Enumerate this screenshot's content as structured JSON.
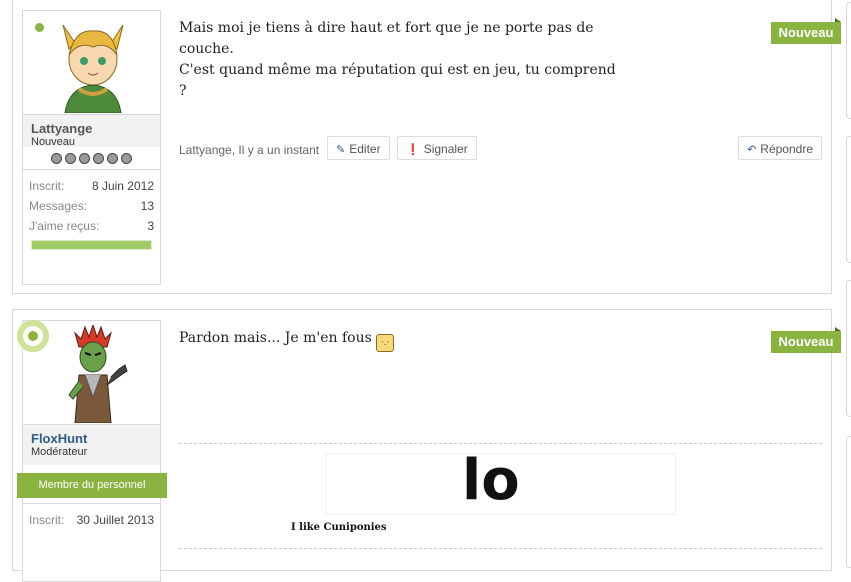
{
  "posts": [
    {
      "author": "Lattyange",
      "user_title": "Nouveau",
      "online": true,
      "rating_balls": [
        "grey",
        "grey",
        "grey",
        "grey",
        "grey",
        "grey"
      ],
      "stats": [
        {
          "label": "Inscrit:",
          "value": "8 Juin 2012"
        },
        {
          "label": "Messages:",
          "value": "13"
        },
        {
          "label": "J'aime reçus:",
          "value": "3"
        }
      ],
      "like_progress": 1.0,
      "message_lines": [
        "Mais moi je tiens à dire haut et fort que je ne porte pas de couche.",
        "C'est quand même ma réputation qui est en jeu, tu comprend ?"
      ],
      "badge": "Nouveau",
      "date_text": "Lattyange, Il y a un instant",
      "edit_label": "Editer",
      "report_label": "Signaler",
      "reply_label": "Répondre"
    },
    {
      "author": "FloxHunt",
      "user_title": "Modérateur",
      "staff_banner": "Membre du personnel",
      "online": true,
      "rating_balls": [
        "yellow",
        "yellow",
        "red",
        "red",
        "red",
        "red"
      ],
      "stats": [
        {
          "label": "Inscrit:",
          "value": "30 Juillet 2013"
        }
      ],
      "message_text": "Pardon mais... Je m'en fous",
      "badge": "Nouveau",
      "signature_text": "lo",
      "signature_caption": "I like Cuniponies"
    }
  ],
  "colors": {
    "accent": "#8ab33f",
    "username_link": "#2f5c8c",
    "border": "#d9d9d9"
  },
  "icons": {
    "edit": "pencil-icon",
    "report": "exclamation-circle-icon",
    "reply": "reply-arrow-icon"
  }
}
